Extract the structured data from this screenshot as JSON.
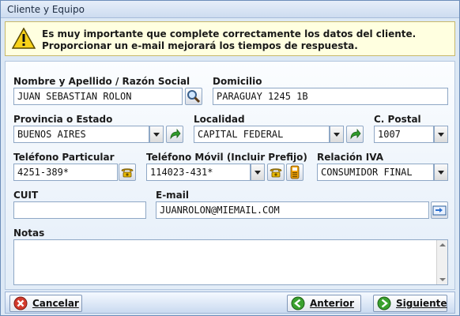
{
  "window": {
    "title": "Cliente y Equipo"
  },
  "banner": {
    "line1": "Es muy importante que complete correctamente los datos del cliente.",
    "line2": "Proporcionar un e-mail mejorará los tiempos de respuesta."
  },
  "form": {
    "nombre": {
      "label": "Nombre y Apellido / Razón Social",
      "value": "JUAN SEBASTIAN ROLON"
    },
    "domicilio": {
      "label": "Domicilio",
      "value": "PARAGUAY 1245 1B"
    },
    "provincia": {
      "label": "Provincia o Estado",
      "value": "BUENOS AIRES"
    },
    "localidad": {
      "label": "Localidad",
      "value": "CAPITAL FEDERAL"
    },
    "cpostal": {
      "label": "C. Postal",
      "value": "1007"
    },
    "tel_particular": {
      "label": "Teléfono Particular",
      "value": "4251-389*"
    },
    "tel_movil": {
      "label": "Teléfono Móvil (Incluir Prefijo)",
      "value": "114023-431*"
    },
    "relacion_iva": {
      "label": "Relación IVA",
      "value": "CONSUMIDOR FINAL"
    },
    "cuit": {
      "label": "CUIT",
      "value": ""
    },
    "email": {
      "label": "E-mail",
      "value": "JUANROLON@MIEMAIL.COM"
    },
    "notas": {
      "label": "Notas",
      "value": ""
    }
  },
  "footer": {
    "cancel_label": "Cancelar",
    "back_label": "Anterior",
    "next_label": "Siguiente"
  },
  "icons": {
    "search": "magnifier-icon",
    "refresh": "green-arrow-icon",
    "phone": "phone-icon",
    "sms": "sms-icon",
    "email_sync": "email-sync-icon"
  },
  "colors": {
    "window_bg": "#dce8f5",
    "banner_bg": "#ffffe0",
    "cancel_icon": "#d33a2c",
    "nav_icon": "#3aa12e"
  }
}
